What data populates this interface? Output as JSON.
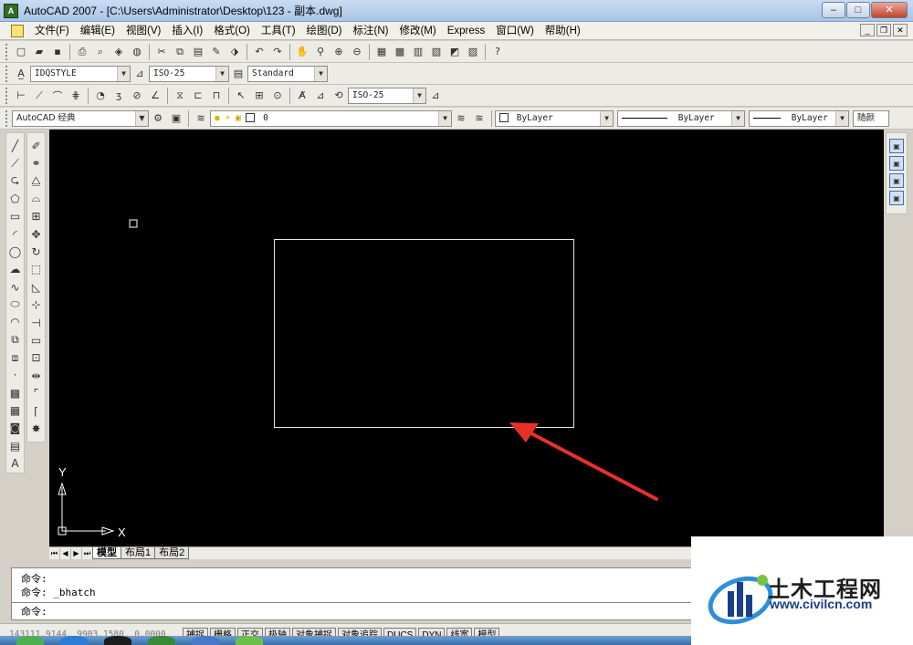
{
  "window": {
    "title": "AutoCAD 2007 - [C:\\Users\\Administrator\\Desktop\\123 - 副本.dwg]",
    "app_icon": "acad-icon"
  },
  "menu": {
    "items": [
      "文件(F)",
      "编辑(E)",
      "视图(V)",
      "插入(I)",
      "格式(O)",
      "工具(T)",
      "绘图(D)",
      "标注(N)",
      "修改(M)",
      "Express",
      "窗口(W)",
      "帮助(H)"
    ]
  },
  "toolbars": {
    "styles": {
      "text_style": "IDQSTYLE",
      "dim_style": "ISO-25",
      "table_style": "Standard"
    },
    "dimension": {
      "dim_style": "ISO-25"
    },
    "workspace": {
      "name": "AutoCAD 经典",
      "layer": "0"
    },
    "properties": {
      "color": "ByLayer",
      "linetype": "ByLayer",
      "lineweight": "ByLayer",
      "plot_style": "随颜"
    }
  },
  "canvas": {
    "background": "#000000",
    "ucs_x_label": "X",
    "ucs_y_label": "Y"
  },
  "layout_tabs": {
    "tabs": [
      "模型",
      "布局1",
      "布局2"
    ],
    "active": "模型"
  },
  "command": {
    "history": [
      "命令:",
      "命令: _bhatch"
    ],
    "prompt": "命令:"
  },
  "status": {
    "coords": "143111.9144, 9903.1580, 0.0000",
    "buttons": [
      "捕捉",
      "栅格",
      "正交",
      "极轴",
      "对象捕捉",
      "对象追踪",
      "DUCS",
      "DYN",
      "线宽",
      "模型"
    ]
  },
  "watermark": {
    "brand": "土木工程网",
    "url": "www.civilcn.com"
  }
}
